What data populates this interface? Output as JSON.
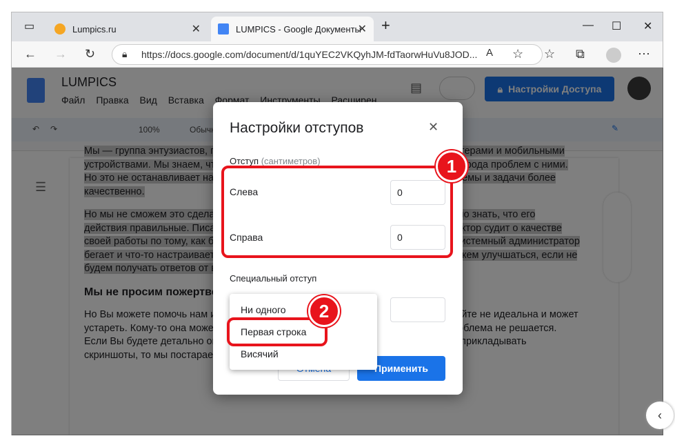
{
  "browser": {
    "tabs": [
      {
        "label": "Lumpics.ru",
        "close": "✕"
      },
      {
        "label": "LUMPICS - Google Документы",
        "close": "✕"
      }
    ],
    "new_tab": "+",
    "url": "https://docs.google.com/document/d/1quYEC2VKQyhJM-fdTaorwHuVu8JOD..."
  },
  "docs": {
    "title": "LUMPICS",
    "menu": [
      "Файл",
      "Правка",
      "Вид",
      "Вставка",
      "Формат",
      "Инструменты",
      "Расширен"
    ],
    "share_button": "Настройки Доступа",
    "toolbar": {
      "zoom": "100%",
      "style": "Обычн"
    },
    "text": {
      "p1": "Мы — группа энтузиастов, помогающих людям в ежедневном контакте с компьютерами и мобильными устройствами. Мы знаем, что в интернете полно информации о решении разного рода проблем с ними. Но это не останавливает нас, чтобы рассказывать вам, как решать многие проблемы и задачи более качественно.",
      "p2": "Но мы не сможем это сделать без вашей обратной связи. Любому человеку важно знать, что его действия правильные. Писатель судит о своей работе по отзывам читателей. Доктор судит о качестве своей работы по тому, как быстро выздоравливают его пациенты. Чем меньше системный администратор бегает и что-то настраивает, тем он качественнее делает работу. Так и мы не можем улучшаться, если не будем получать ответов от вас.",
      "h": "Мы не просим пожертвований",
      "p3": "Но Вы можете помочь нам и нашим посетителям. Не каждая статья на нашем сайте не идеальна и может устареть. Кому-то она может помочь, кому-то нет. И нам важно знать, почему проблема не решается. Если Вы будете детально описывать свои действия в комментариях к статьям и прикладывать скриншоты, то мы постараемся Вам помочь."
    }
  },
  "dialog": {
    "title": "Настройки отступов",
    "indent_label": "Отступ",
    "indent_units": "(сантиметров)",
    "left_label": "Слева",
    "left_value": "0",
    "right_label": "Справа",
    "right_value": "0",
    "special_label": "Специальный отступ",
    "special_options": [
      "Ни одного",
      "Первая строка",
      "Висячий"
    ],
    "cancel": "Отмена",
    "apply": "Применить"
  },
  "annotations": {
    "badge1": "1",
    "badge2": "2",
    "color": "#e8141c"
  }
}
